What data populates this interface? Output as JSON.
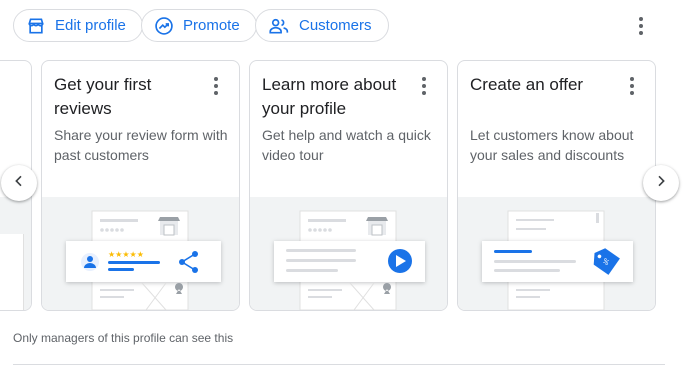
{
  "toolbar": {
    "edit_label": "Edit profile",
    "promote_label": "Promote",
    "customers_label": "Customers"
  },
  "cards": [
    {
      "title": "Get your first reviews",
      "description": "Share your review form with past customers",
      "illustration": "review-stars-share-icon"
    },
    {
      "title": "Learn more about your profile",
      "description": "Get help and watch a quick video tour",
      "illustration": "video-play-icon"
    },
    {
      "title": "Create an offer",
      "description": "Let customers know about your sales and discounts",
      "illustration": "offer-tag-icon"
    }
  ],
  "footer": {
    "note": "Only managers of this profile can see this"
  },
  "colors": {
    "accent": "#1a73e8",
    "star": "#fbbc04",
    "muted": "#5f6368",
    "border": "#dadce0",
    "illustration_bg": "#f1f3f4"
  }
}
